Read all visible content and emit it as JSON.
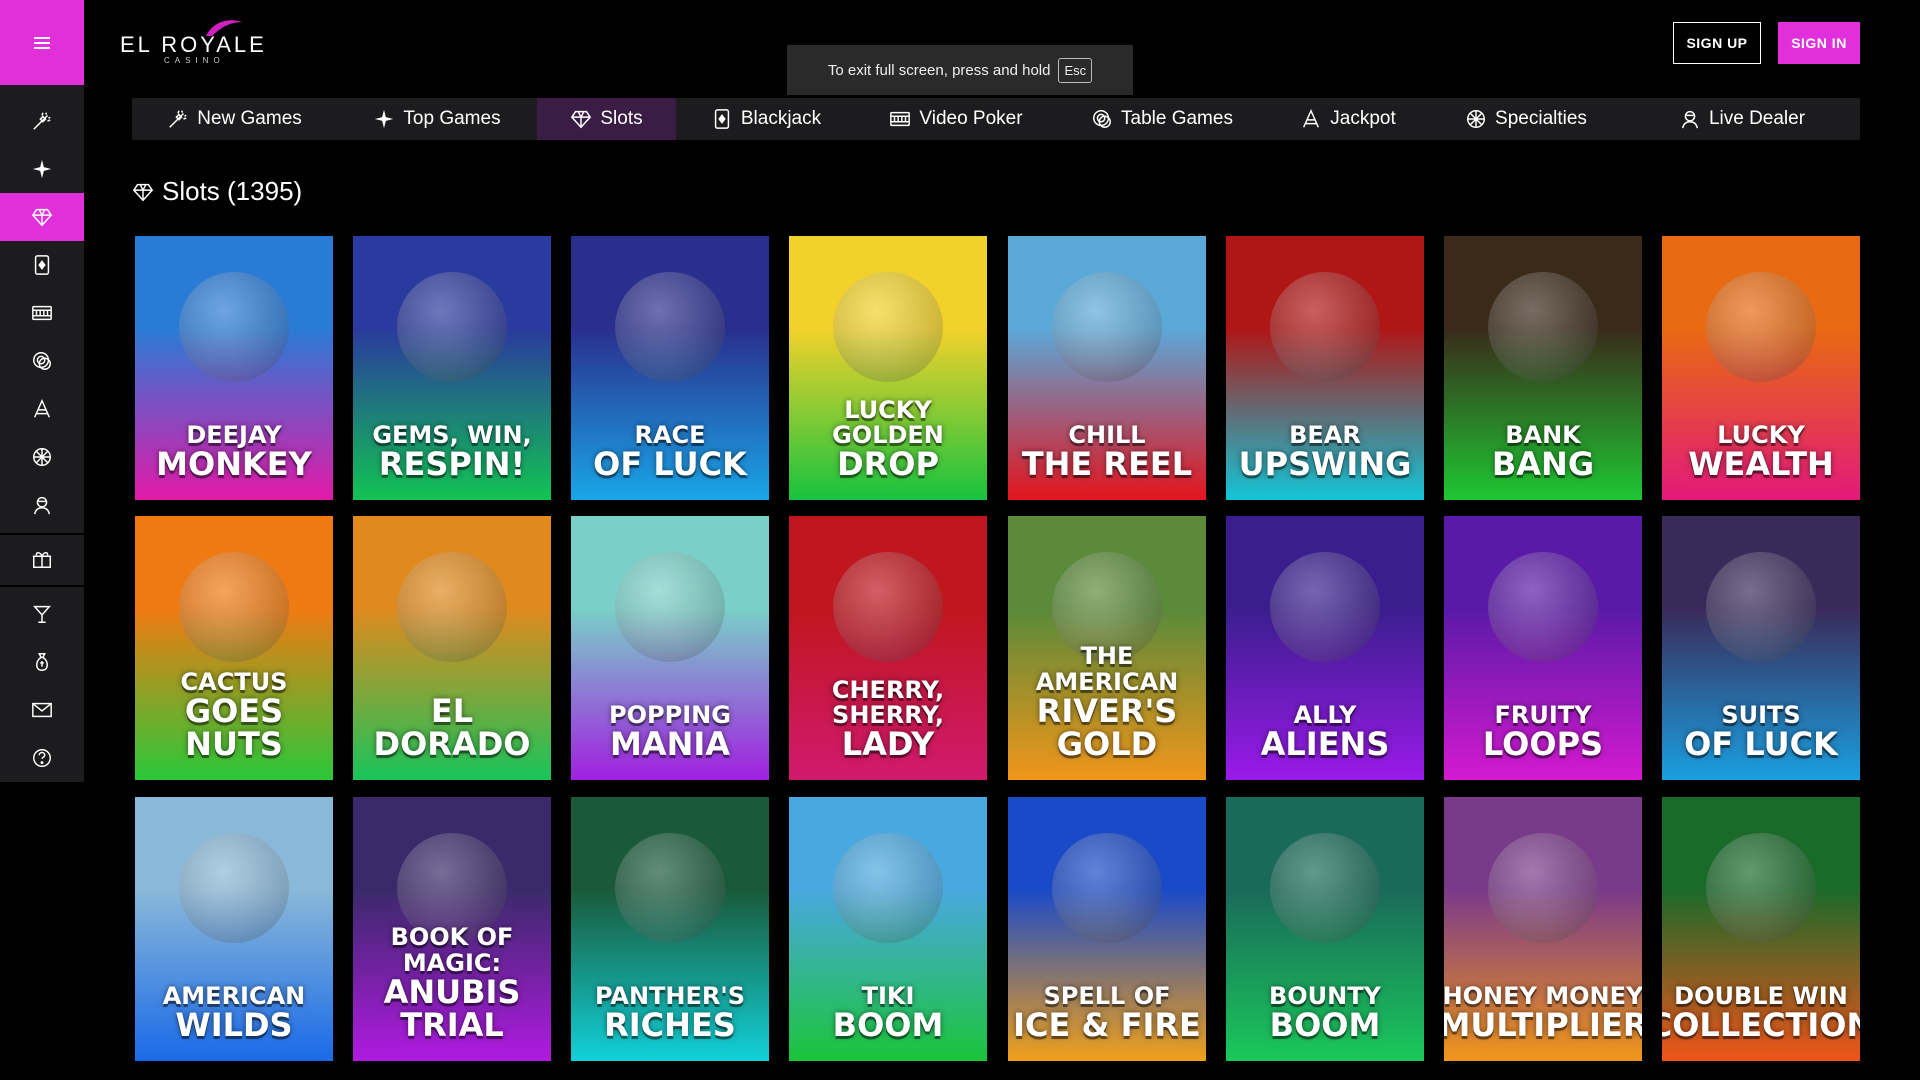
{
  "header": {
    "logo_text": "EL ROYALE",
    "logo_sub": "CASINO",
    "fullscreen_notice": "To exit full screen, press and hold",
    "fullscreen_key": "Esc",
    "signup_label": "SIGN UP",
    "signin_label": "SIGN IN"
  },
  "sidebar": {
    "items": [
      {
        "icon": "new-games-icon"
      },
      {
        "icon": "top-games-icon"
      },
      {
        "icon": "slots-icon",
        "active": true
      },
      {
        "icon": "blackjack-icon"
      },
      {
        "icon": "video-poker-icon"
      },
      {
        "icon": "table-games-icon"
      },
      {
        "icon": "jackpot-icon"
      },
      {
        "icon": "specialties-icon"
      },
      {
        "icon": "live-dealer-icon"
      },
      {
        "icon": "promotions-gift-icon"
      },
      {
        "icon": "cocktail-icon"
      },
      {
        "icon": "banking-icon"
      },
      {
        "icon": "mail-icon"
      },
      {
        "icon": "help-icon"
      }
    ]
  },
  "tabs": [
    {
      "label": "New Games",
      "icon": "new-games-icon"
    },
    {
      "label": "Top Games",
      "icon": "top-games-icon"
    },
    {
      "label": "Slots",
      "icon": "slots-icon",
      "active": true
    },
    {
      "label": "Blackjack",
      "icon": "blackjack-icon"
    },
    {
      "label": "Video Poker",
      "icon": "video-poker-icon"
    },
    {
      "label": "Table Games",
      "icon": "table-games-icon"
    },
    {
      "label": "Jackpot",
      "icon": "jackpot-icon"
    },
    {
      "label": "Specialties",
      "icon": "specialties-icon"
    },
    {
      "label": "Live Dealer",
      "icon": "live-dealer-icon"
    }
  ],
  "section": {
    "title": "Slots (1395)"
  },
  "games": [
    {
      "line1": "Deejay",
      "line2": "Monkey",
      "c1": "#2a7bd6",
      "c2": "#e21aa8"
    },
    {
      "line1": "Gems, Win,",
      "line2": "Respin!",
      "c1": "#2a3a9e",
      "c2": "#12c454"
    },
    {
      "line1": "Race",
      "line2": "of Luck",
      "c1": "#2a2f8e",
      "c2": "#1aa6e8"
    },
    {
      "line1": "Lucky Golden",
      "line2": "Drop",
      "c1": "#f2d22a",
      "c2": "#17c23f"
    },
    {
      "line1": "Chill",
      "line2": "The Reel",
      "c1": "#5aa8d8",
      "c2": "#e3141e"
    },
    {
      "line1": "Bear",
      "line2": "Upswing",
      "c1": "#b01616",
      "c2": "#12c6d8"
    },
    {
      "line1": "Bank",
      "line2": "Bang",
      "c1": "#3a2a1a",
      "c2": "#1ec832"
    },
    {
      "line1": "Lucky",
      "line2": "Wealth",
      "c1": "#e86a12",
      "c2": "#e3197a"
    },
    {
      "line1": "Cactus",
      "line2": "Goes Nuts",
      "c1": "#f07a12",
      "c2": "#2ac83a"
    },
    {
      "line1": "",
      "line2": "El Dorado",
      "c1": "#e08a1e",
      "c2": "#19c45a"
    },
    {
      "line1": "Popping",
      "line2": "Mania",
      "c1": "#7ad0c8",
      "c2": "#a020e0"
    },
    {
      "line1": "Cherry, Sherry,",
      "line2": "Lady",
      "c1": "#c0161e",
      "c2": "#d01a6e"
    },
    {
      "line1": "The American",
      "line2": "River's Gold",
      "c1": "#5a8a3a",
      "c2": "#f0961a"
    },
    {
      "line1": "Ally",
      "line2": "Aliens",
      "c1": "#3a1e8e",
      "c2": "#9a1ae8"
    },
    {
      "line1": "Fruity",
      "line2": "Loops",
      "c1": "#5a1aa8",
      "c2": "#d41ad0"
    },
    {
      "line1": "Suits",
      "line2": "of Luck",
      "c1": "#3a2a5a",
      "c2": "#1aa0e0"
    },
    {
      "line1": "American",
      "line2": "Wilds",
      "c1": "#8ab8d8",
      "c2": "#1a6ae8"
    },
    {
      "line1": "Book of Magic:",
      "line2": "Anubis Trial",
      "c1": "#3a2a6a",
      "c2": "#b01ae0"
    },
    {
      "line1": "Panther's",
      "line2": "Riches",
      "c1": "#1a5a3a",
      "c2": "#12d0d8"
    },
    {
      "line1": "Tiki",
      "line2": "Boom",
      "c1": "#4aa8e0",
      "c2": "#1ac43a"
    },
    {
      "line1": "Spell of",
      "line2": "Ice & Fire",
      "c1": "#1a4ac8",
      "c2": "#f0a01a"
    },
    {
      "line1": "Bounty",
      "line2": "Boom",
      "c1": "#1a6a5a",
      "c2": "#1ac85a"
    },
    {
      "line1": "Honey Money",
      "line2": "Multiplier",
      "c1": "#7a3a8a",
      "c2": "#f0961a"
    },
    {
      "line1": "Double Win",
      "line2": "Collection",
      "c1": "#1a6a2a",
      "c2": "#f0541a"
    }
  ]
}
